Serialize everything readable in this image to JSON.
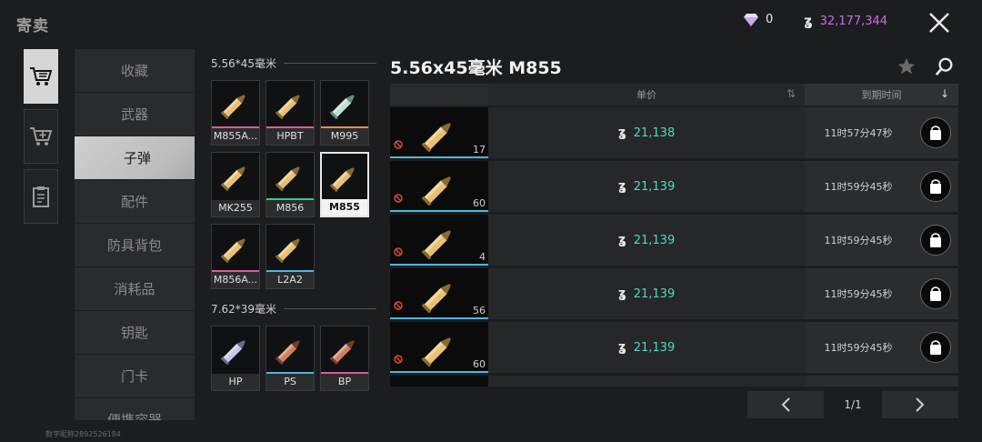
{
  "header": {
    "title": "寄卖",
    "diamond_balance": "0",
    "coin_balance": "32,177,344"
  },
  "colors": {
    "accent_price": "#4fd8c0",
    "coin_balance": "#c86fe0",
    "rarity_pink": "#e05a9a",
    "rarity_orange": "#e8903a",
    "rarity_green": "#3ad07a",
    "rarity_blue": "#4fb6e0"
  },
  "rail": {
    "icons": [
      "cart-icon",
      "cart-add-icon",
      "clipboard-icon"
    ]
  },
  "categories": [
    {
      "label": "收藏"
    },
    {
      "label": "武器"
    },
    {
      "label": "子弹"
    },
    {
      "label": "配件"
    },
    {
      "label": "防具背包"
    },
    {
      "label": "消耗品"
    },
    {
      "label": "钥匙"
    },
    {
      "label": "门卡"
    },
    {
      "label": "便携容器"
    }
  ],
  "ammo_groups": [
    {
      "title": "5.56*45毫米",
      "items": [
        {
          "label": "M855A...",
          "rarity": "pink",
          "tint": "gold"
        },
        {
          "label": "HPBT",
          "rarity": "pink",
          "tint": "gold"
        },
        {
          "label": "M995",
          "rarity": "orange",
          "tint": "teal"
        },
        {
          "label": "MK255",
          "rarity": "none",
          "tint": "gold"
        },
        {
          "label": "M856",
          "rarity": "green",
          "tint": "gold"
        },
        {
          "label": "M855",
          "rarity": "none",
          "tint": "gold",
          "selected": true
        },
        {
          "label": "M856A...",
          "rarity": "pink",
          "tint": "gold"
        },
        {
          "label": "L2A2",
          "rarity": "blue",
          "tint": "gold"
        }
      ]
    },
    {
      "title": "7.62*39毫米",
      "items": [
        {
          "label": "HP",
          "rarity": "none",
          "tint": "silver"
        },
        {
          "label": "PS",
          "rarity": "blue",
          "tint": "copper"
        },
        {
          "label": "BP",
          "rarity": "pink",
          "tint": "copper"
        }
      ]
    }
  ],
  "listing": {
    "title": "5.56x45毫米 M855",
    "col_price": "单价",
    "col_expire": "到期时间",
    "rows": [
      {
        "qty": "17",
        "price": "21,138",
        "expire": "11时57分47秒"
      },
      {
        "qty": "60",
        "price": "21,139",
        "expire": "11时59分45秒"
      },
      {
        "qty": "4",
        "price": "21,139",
        "expire": "11时59分45秒"
      },
      {
        "qty": "56",
        "price": "21,139",
        "expire": "11时59分45秒"
      },
      {
        "qty": "60",
        "price": "21,139",
        "expire": "11时59分45秒"
      }
    ]
  },
  "pager": {
    "page": "1/1"
  },
  "watermark": "数字昵称2892526184"
}
